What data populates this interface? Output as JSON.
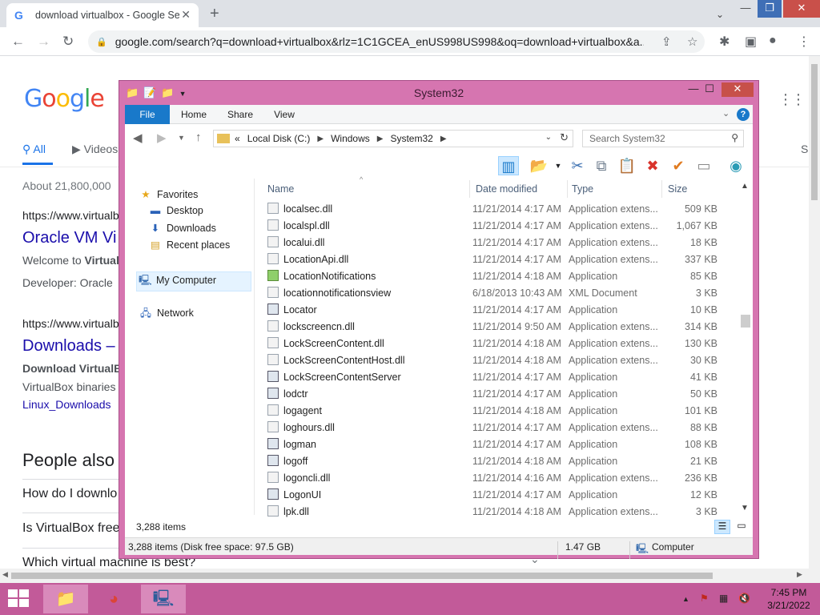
{
  "browser": {
    "tab_title": "download virtualbox - Google Se",
    "tab_favicon": "G",
    "url": "google.com/search?q=download+virtualbox&rlz=1C1GCEA_enUS998US998&oq=download+virtualbox&a..."
  },
  "google": {
    "tabs": [
      "All",
      "Videos"
    ],
    "tab_cut": "S",
    "stats": "About 21,800,000",
    "results": [
      {
        "cite": "https://www.virtualb",
        "title": "Oracle VM Vi",
        "snippet1_plain": "Welcome to ",
        "snippet1_bold": "Virtual",
        "snippet2": "Developer: Oracle"
      },
      {
        "cite": "https://www.virtualb",
        "title": "Downloads –",
        "snippet1_bold": "Download VirtualBo",
        "snippet2": "VirtualBox binaries",
        "link": "Linux_Downloads"
      }
    ],
    "people_also": "People also a",
    "questions": [
      "How do I downlo",
      "Is VirtualBox free",
      "Which virtual machine is best?"
    ]
  },
  "explorer": {
    "title": "System32",
    "ribbon_tabs": {
      "file": "File",
      "home": "Home",
      "share": "Share",
      "view": "View"
    },
    "address": {
      "lead": "«",
      "crumbs": [
        "Local Disk (C:)",
        "Windows",
        "System32"
      ]
    },
    "search_placeholder": "Search System32",
    "nav": {
      "favorites": "Favorites",
      "desktop": "Desktop",
      "downloads": "Downloads",
      "recent": "Recent places",
      "computer": "My Computer",
      "network": "Network"
    },
    "columns": {
      "name": "Name",
      "date": "Date modified",
      "type": "Type",
      "size": "Size"
    },
    "files": [
      {
        "name": "localsec.dll",
        "date": "11/21/2014 4:17 AM",
        "type": "Application extens...",
        "size": "509 KB",
        "kind": "dll"
      },
      {
        "name": "localspl.dll",
        "date": "11/21/2014 4:17 AM",
        "type": "Application extens...",
        "size": "1,067 KB",
        "kind": "dll"
      },
      {
        "name": "localui.dll",
        "date": "11/21/2014 4:17 AM",
        "type": "Application extens...",
        "size": "18 KB",
        "kind": "dll"
      },
      {
        "name": "LocationApi.dll",
        "date": "11/21/2014 4:17 AM",
        "type": "Application extens...",
        "size": "337 KB",
        "kind": "dll"
      },
      {
        "name": "LocationNotifications",
        "date": "11/21/2014 4:18 AM",
        "type": "Application",
        "size": "85 KB",
        "kind": "ok"
      },
      {
        "name": "locationnotificationsview",
        "date": "6/18/2013 10:43 AM",
        "type": "XML Document",
        "size": "3 KB",
        "kind": "dll"
      },
      {
        "name": "Locator",
        "date": "11/21/2014 4:17 AM",
        "type": "Application",
        "size": "10 KB",
        "kind": "app"
      },
      {
        "name": "lockscreencn.dll",
        "date": "11/21/2014 9:50 AM",
        "type": "Application extens...",
        "size": "314 KB",
        "kind": "dll"
      },
      {
        "name": "LockScreenContent.dll",
        "date": "11/21/2014 4:18 AM",
        "type": "Application extens...",
        "size": "130 KB",
        "kind": "dll"
      },
      {
        "name": "LockScreenContentHost.dll",
        "date": "11/21/2014 4:18 AM",
        "type": "Application extens...",
        "size": "30 KB",
        "kind": "dll"
      },
      {
        "name": "LockScreenContentServer",
        "date": "11/21/2014 4:17 AM",
        "type": "Application",
        "size": "41 KB",
        "kind": "app"
      },
      {
        "name": "lodctr",
        "date": "11/21/2014 4:17 AM",
        "type": "Application",
        "size": "50 KB",
        "kind": "app"
      },
      {
        "name": "logagent",
        "date": "11/21/2014 4:18 AM",
        "type": "Application",
        "size": "101 KB",
        "kind": "dll"
      },
      {
        "name": "loghours.dll",
        "date": "11/21/2014 4:17 AM",
        "type": "Application extens...",
        "size": "88 KB",
        "kind": "dll"
      },
      {
        "name": "logman",
        "date": "11/21/2014 4:17 AM",
        "type": "Application",
        "size": "108 KB",
        "kind": "app"
      },
      {
        "name": "logoff",
        "date": "11/21/2014 4:18 AM",
        "type": "Application",
        "size": "21 KB",
        "kind": "app"
      },
      {
        "name": "logoncli.dll",
        "date": "11/21/2014 4:16 AM",
        "type": "Application extens...",
        "size": "236 KB",
        "kind": "dll"
      },
      {
        "name": "LogonUI",
        "date": "11/21/2014 4:17 AM",
        "type": "Application",
        "size": "12 KB",
        "kind": "app"
      },
      {
        "name": "lpk.dll",
        "date": "11/21/2014 4:18 AM",
        "type": "Application extens...",
        "size": "3 KB",
        "kind": "dll"
      }
    ],
    "item_count": "3,288 items",
    "status_left": "3,288 items (Disk free space: 97.5 GB)",
    "status_size": "1.47 GB",
    "status_location": "Computer"
  },
  "taskbar": {
    "time": "7:45 PM",
    "date": "3/21/2022"
  },
  "colors": {
    "explorer_frame": "#d675b0",
    "taskbar": "#c25a99",
    "link": "#1a0dab"
  }
}
